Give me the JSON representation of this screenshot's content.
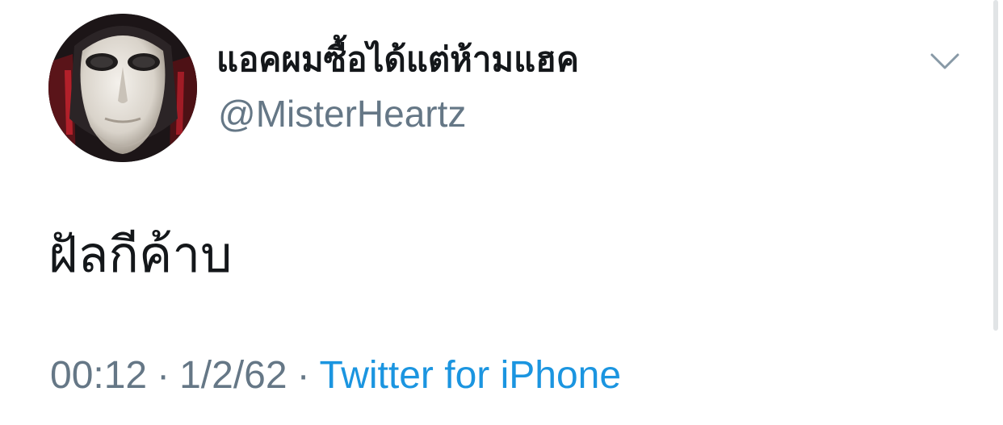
{
  "tweet": {
    "display_name": "แอคผมซื้อได้แต่ห้ามแฮค",
    "handle": "@MisterHeartz",
    "text": "ฝัลกีค้าบ",
    "time": "00:12",
    "separator": "·",
    "date": "1/2/62",
    "source": "Twitter for iPhone"
  },
  "icons": {
    "avatar": "mask-avatar",
    "menu": "chevron-down-icon"
  },
  "colors": {
    "primary_text": "#14171a",
    "secondary_text": "#657786",
    "link": "#1b95e0",
    "background": "#ffffff"
  }
}
